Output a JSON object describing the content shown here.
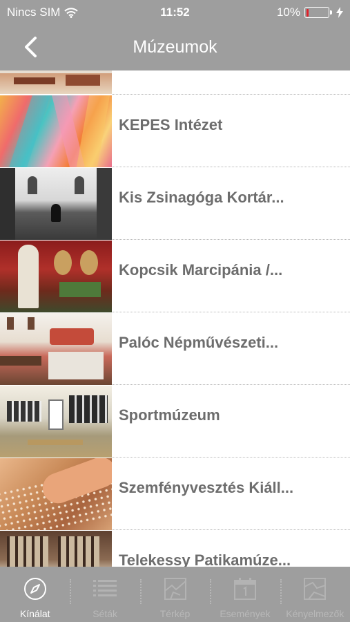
{
  "status": {
    "carrier": "Nincs SIM",
    "time": "11:52",
    "battery": "10%",
    "battery_level": 0.1,
    "icons": [
      "wifi-icon",
      "battery-icon",
      "charging-bolt-icon"
    ]
  },
  "nav": {
    "title": "Múzeumok",
    "back_icon": "chevron-left-icon"
  },
  "list": {
    "items": [
      {
        "label": ""
      },
      {
        "label": "KEPES Intézet"
      },
      {
        "label": "Kis Zsinagóga Kortár..."
      },
      {
        "label": "Kopcsik Marcipánia /..."
      },
      {
        "label": "Palóc Népművészeti..."
      },
      {
        "label": "Sportmúzeum"
      },
      {
        "label": "Szemfényvesztés Kiáll..."
      },
      {
        "label": "Telekessy Patikamúze..."
      }
    ]
  },
  "tabbar": {
    "tabs": [
      {
        "label": "Kínálat",
        "icon": "compass-icon",
        "active": true
      },
      {
        "label": "Séták",
        "icon": "list-icon",
        "active": false
      },
      {
        "label": "Térkép",
        "icon": "map-icon",
        "active": false
      },
      {
        "label": "Események",
        "icon": "calendar-icon",
        "active": false
      },
      {
        "label": "Kényelmezők",
        "icon": "map-icon",
        "active": false
      }
    ]
  },
  "colors": {
    "bar": "#9e9e9e",
    "label": "#6d6d6d",
    "battery_low": "#e0202a"
  }
}
